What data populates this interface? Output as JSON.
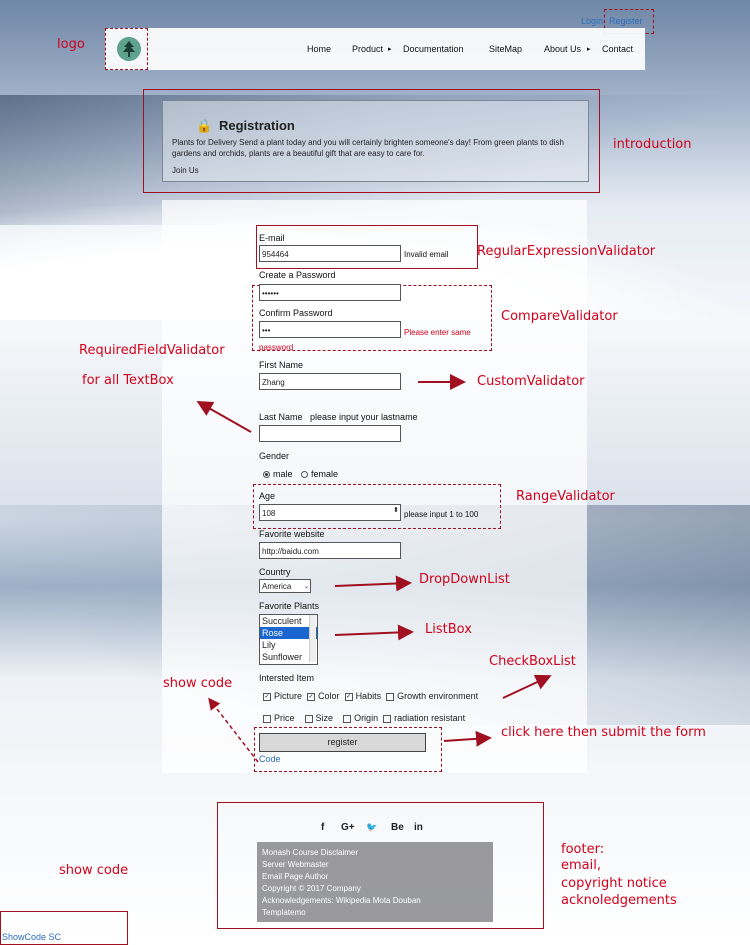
{
  "header": {
    "login": "Login",
    "register": "Register",
    "nav": [
      "Home",
      "Product",
      "Documentation",
      "SiteMap",
      "About Us",
      "Contact"
    ],
    "product_arrow": "▸",
    "about_arrow": "▸"
  },
  "intro": {
    "title": "Registration",
    "text": "Plants for Delivery Send a plant today and you will certainly brighten someone's day! From green plants to dish gardens and orchids, plants are a beautiful gift that are easy to care for.",
    "join": "Join Us"
  },
  "form": {
    "email_label": "E-mail",
    "email_value": "954464",
    "email_error": "Invalid email",
    "password_label": "Create a Password",
    "password_value": "••••••",
    "confirm_label": "Confirm Password",
    "confirm_value": "•••",
    "confirm_error": "Please enter same password",
    "firstname_label": "First Name",
    "firstname_value": "Zhang",
    "lastname_label": "Last Name",
    "lastname_error": "please input your lastname",
    "lastname_value": "",
    "gender_label": "Gender",
    "gender_male": "male",
    "gender_female": "female",
    "age_label": "Age",
    "age_value": "108",
    "age_error": "please input 1 to 100",
    "website_label": "Favorite website",
    "website_value": "http://baidu.com",
    "country_label": "Country",
    "country_value": "America",
    "plants_label": "Favorite Plants",
    "plants": [
      "Succulent",
      "Rose",
      "Lily",
      "Sunflower"
    ],
    "interest_label": "Intersted Item",
    "interest_row1": [
      "Picture",
      "Color",
      "Habits",
      "Growth environment"
    ],
    "interest_row2": [
      "Price",
      "Size",
      "Origin",
      "radiation resistant"
    ],
    "register_button": "register",
    "code_link": "Code"
  },
  "footer": {
    "social": [
      "f",
      "G+",
      "🐦",
      "Be",
      "in"
    ],
    "lines": [
      "Monash Course Disclaimer",
      "Server Webmaster",
      "Email Page Author",
      "Copyright © 2017 Company",
      "Acknowledgements: Wikipedia   Mota   Douban",
      "Templatemo"
    ]
  },
  "bottom_link": "ShowCode SC",
  "annotations": {
    "logo": "logo",
    "introduction": "introduction",
    "regex": "RegularExpressionValidator",
    "compare": "CompareValidator",
    "required": "RequiredFieldValidator",
    "required2": "for all TextBox",
    "custom": "CustomValidator",
    "range": "RangeValidator",
    "dropdown": "DropDownList",
    "listbox": "ListBox",
    "checkbox": "CheckBoxList",
    "showcode": "show code",
    "submit": "click here then submit the form",
    "showcode2": "show code",
    "footer1": "footer:",
    "footer2": "email,",
    "footer3": "copyright notice",
    "footer4": "acknoledgements"
  }
}
